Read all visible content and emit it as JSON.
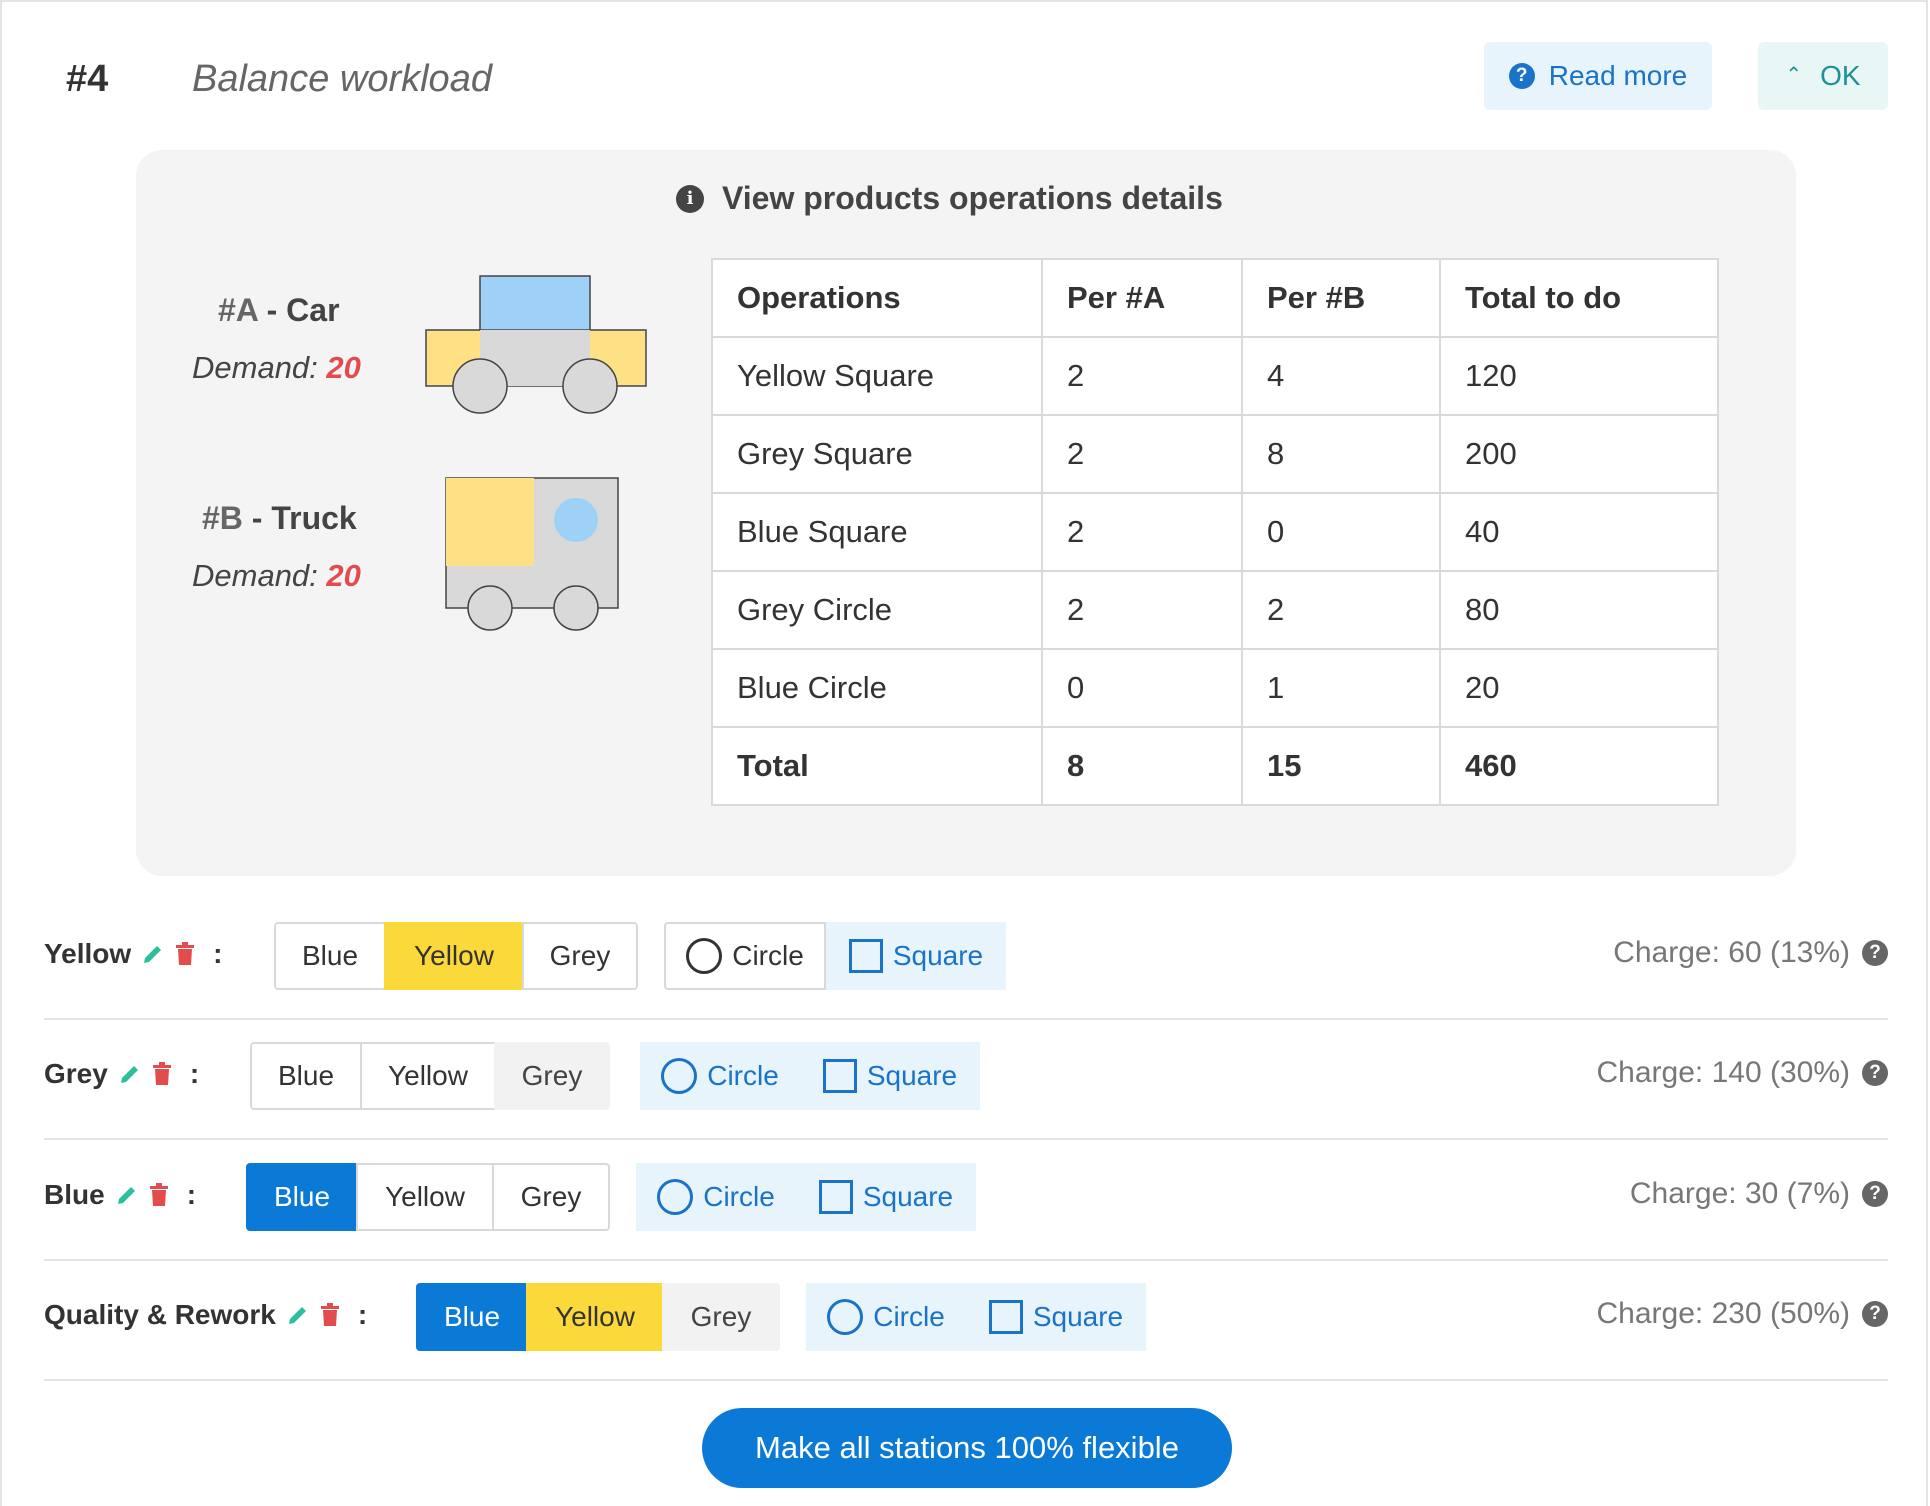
{
  "header": {
    "step_number": "#4",
    "step_title": "Balance workload",
    "read_more_label": "Read more",
    "ok_label": "OK"
  },
  "panel": {
    "title": "View products operations details",
    "products": [
      {
        "id": "#A",
        "sep": " - ",
        "name": "Car",
        "demand_label": "Demand:",
        "demand": "20"
      },
      {
        "id": "#B",
        "sep": " - ",
        "name": "Truck",
        "demand_label": "Demand:",
        "demand": "20"
      }
    ],
    "table": {
      "headers": [
        "Operations",
        "Per #A",
        "Per #B",
        "Total to do"
      ],
      "rows": [
        [
          "Yellow Square",
          "2",
          "4",
          "120"
        ],
        [
          "Grey Square",
          "2",
          "8",
          "200"
        ],
        [
          "Blue Square",
          "2",
          "0",
          "40"
        ],
        [
          "Grey Circle",
          "2",
          "2",
          "80"
        ],
        [
          "Blue Circle",
          "0",
          "1",
          "20"
        ]
      ],
      "total": [
        "Total",
        "8",
        "15",
        "460"
      ]
    }
  },
  "stations": [
    {
      "name": "Yellow",
      "colors": [
        "Blue",
        "Yellow",
        "Grey"
      ],
      "shapes": [
        "Circle",
        "Square"
      ],
      "charge": "Charge: 60 (13%)"
    },
    {
      "name": "Grey",
      "colors": [
        "Blue",
        "Yellow",
        "Grey"
      ],
      "shapes": [
        "Circle",
        "Square"
      ],
      "charge": "Charge: 140 (30%)"
    },
    {
      "name": "Blue",
      "colors": [
        "Blue",
        "Yellow",
        "Grey"
      ],
      "shapes": [
        "Circle",
        "Square"
      ],
      "charge": "Charge: 30 (7%)"
    },
    {
      "name": "Quality & Rework",
      "colors": [
        "Blue",
        "Yellow",
        "Grey"
      ],
      "shapes": [
        "Circle",
        "Square"
      ],
      "charge": "Charge: 230 (50%)"
    }
  ],
  "colon": ":",
  "flex_button_label": "Make all stations 100% flexible",
  "colors": {
    "accent_blue": "#0b7ad6",
    "selected_yellow": "#fcd93a",
    "selected_grey": "#f2f2f2",
    "demand_red": "#e24c4c",
    "edit_green": "#2bbf9b",
    "delete_red": "#e24c4c"
  },
  "icons": {
    "read_more": "question-circle-icon",
    "ok": "chevron-up-icon",
    "panel_title": "info-circle-icon",
    "edit": "pencil-icon",
    "delete": "trash-icon",
    "charge_help": "question-circle-icon",
    "shape_circle": "circle-outline-icon",
    "shape_square": "square-outline-icon"
  }
}
